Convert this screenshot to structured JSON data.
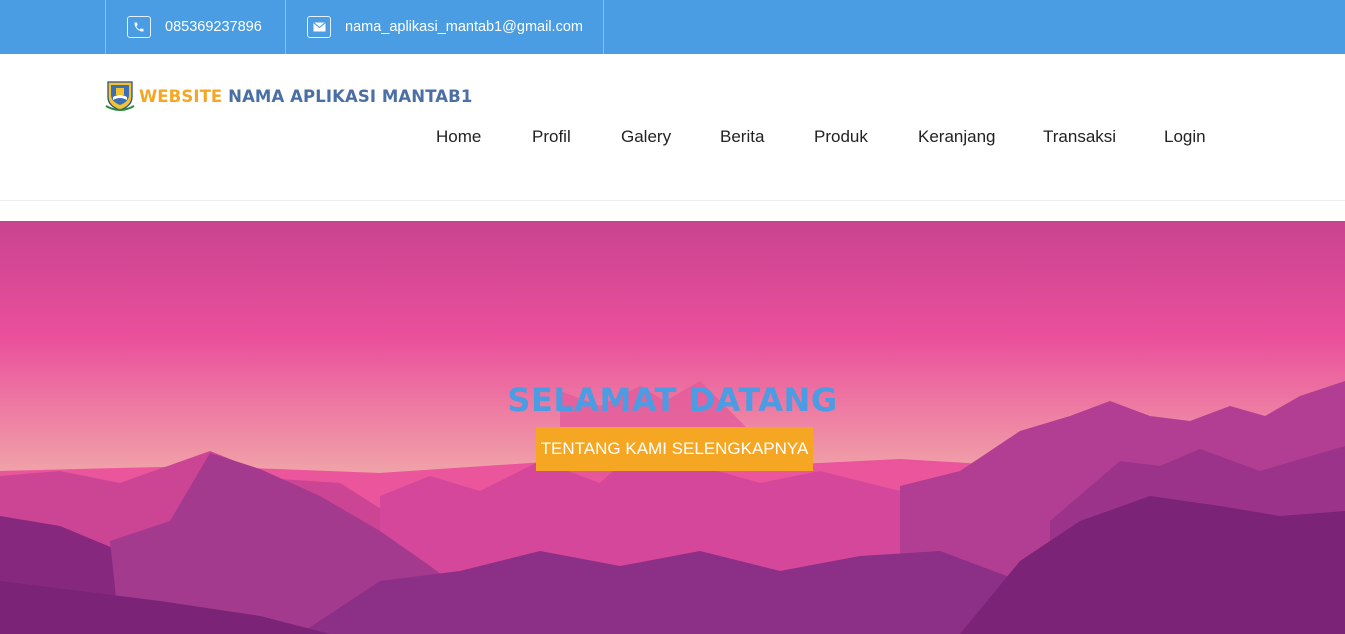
{
  "topbar": {
    "phone": {
      "icon": "phone-icon",
      "text": "085369237896"
    },
    "email": {
      "icon": "envelope-icon",
      "text": "nama_aplikasi_mantab1@gmail.com"
    },
    "color": "#4a9de2"
  },
  "brand": {
    "logo_icon": "emblem-logo-icon",
    "accent_text": "WEBSITE",
    "main_text": "NAMA APLIKASI MANTAB1",
    "accent_color": "#f5a623",
    "main_color": "#4a6fa5"
  },
  "nav": {
    "items": [
      {
        "label": "Home"
      },
      {
        "label": "Profil"
      },
      {
        "label": "Galery"
      },
      {
        "label": "Berita"
      },
      {
        "label": "Produk"
      },
      {
        "label": "Keranjang"
      },
      {
        "label": "Transaksi"
      },
      {
        "label": "Login"
      }
    ]
  },
  "hero": {
    "title": "SELAMAT DATANG",
    "button_label": "TENTANG KAMI SELENGKAPNYA",
    "title_color": "#4a9de2",
    "button_color": "#f5a623",
    "sky_colors": [
      "#c9438f",
      "#ea4f9c",
      "#f0a0a8"
    ]
  }
}
